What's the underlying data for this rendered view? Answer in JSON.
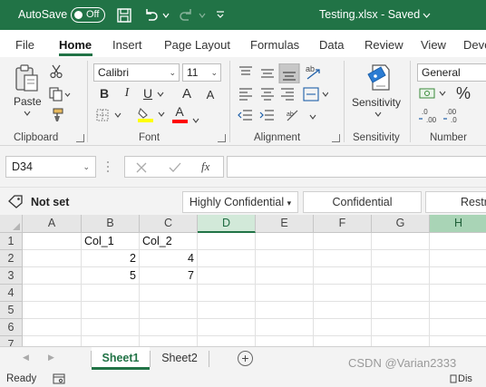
{
  "titlebar": {
    "autosave_label": "AutoSave",
    "toggle_state": "Off",
    "document_title": "Testing.xlsx  -  Saved"
  },
  "ribbon_tabs": [
    "File",
    "Home",
    "Insert",
    "Page Layout",
    "Formulas",
    "Data",
    "Review",
    "View",
    "Devel"
  ],
  "ribbon": {
    "clipboard": {
      "paste_label": "Paste",
      "group_label": "Clipboard"
    },
    "font": {
      "font_name": "Calibri",
      "font_size": "11",
      "group_label": "Font",
      "bold": "B",
      "italic": "I",
      "underline": "U",
      "grow": "A",
      "shrink": "A",
      "font_color_glyph": "A",
      "highlight_color": "#ffff00",
      "font_color": "#ff0000"
    },
    "alignment": {
      "group_label": "Alignment"
    },
    "sensitivity": {
      "label": "Sensitivity",
      "group_label": "Sensitivity"
    },
    "number": {
      "format": "General",
      "group_label": "Number",
      "percent": "%"
    }
  },
  "formula_bar": {
    "name_box": "D34",
    "fx": "fx",
    "formula": ""
  },
  "sensitivity_bar": {
    "label": "Not set",
    "options": [
      "Highly Confidential",
      "Confidential",
      "Restri"
    ]
  },
  "grid": {
    "columns": [
      "A",
      "B",
      "C",
      "D",
      "E",
      "F",
      "G",
      "H"
    ],
    "selected_column": "D",
    "highlighted_column": "H",
    "rows": [
      "1",
      "2",
      "3",
      "4",
      "5",
      "6",
      "7"
    ],
    "cells": {
      "B1": "Col_1",
      "C1": "Col_2",
      "B2": "2",
      "C2": "4",
      "B3": "5",
      "C3": "7"
    }
  },
  "sheets": {
    "tabs": [
      "Sheet1",
      "Sheet2"
    ],
    "active": "Sheet1",
    "add_label": "+"
  },
  "status": {
    "ready": "Ready",
    "right_text": "Dis"
  },
  "watermark": "CSDN @Varian2333",
  "colors": {
    "brand": "#217346"
  }
}
